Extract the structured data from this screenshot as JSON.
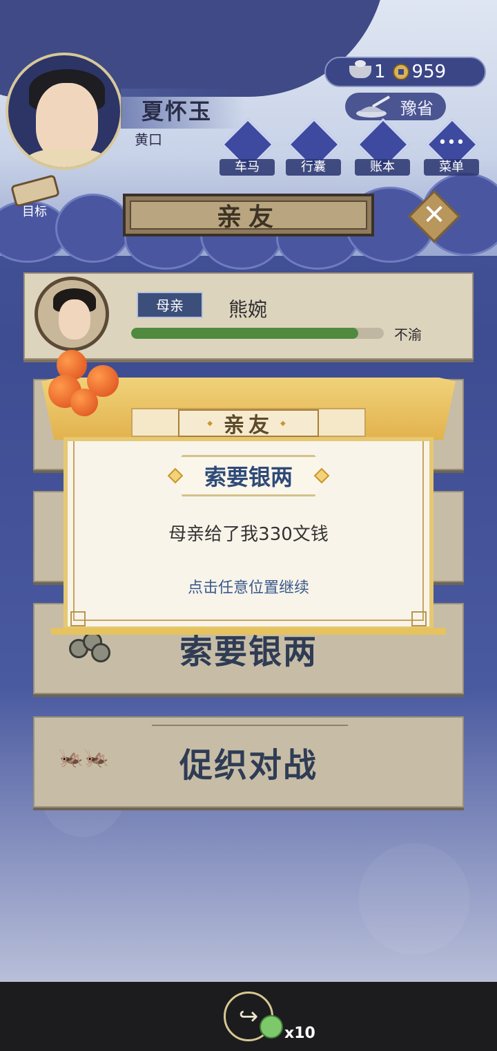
{
  "player": {
    "name": "夏怀玉",
    "rank": "黄口"
  },
  "currency": {
    "silver": "1",
    "coins": "959"
  },
  "location": "豫省",
  "menu": {
    "items": [
      {
        "label": "车马",
        "icon": "carriage-icon"
      },
      {
        "label": "行囊",
        "icon": "bag-icon"
      },
      {
        "label": "账本",
        "icon": "ledger-icon"
      },
      {
        "label": "菜单",
        "icon": "menu-dots-icon"
      }
    ],
    "goal_label": "目标"
  },
  "screen": {
    "title": "亲友"
  },
  "relative": {
    "relation": "母亲",
    "name": "熊婉",
    "mood": "不渝",
    "mood_fill": 0.9
  },
  "actions": {
    "ask_money": "索要银两",
    "cricket_battle": "促织对战"
  },
  "modal": {
    "title": "亲友",
    "subtitle": "索要银两",
    "message": "母亲给了我330文钱",
    "hint": "点击任意位置继续"
  },
  "footer": {
    "share_count": "x10"
  },
  "colors": {
    "accent_gold": "#e2b24d",
    "navy": "#2e4a78",
    "mood_green": "#4f8a3e"
  }
}
